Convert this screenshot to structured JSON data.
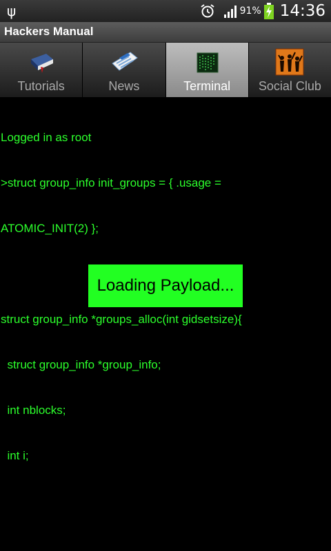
{
  "status_bar": {
    "battery_percent": "91%",
    "time": "14:36",
    "icons": [
      "usb-icon",
      "alarm-icon",
      "signal-icon",
      "battery-charging-icon"
    ]
  },
  "app": {
    "title": "Hackers Manual"
  },
  "tabs": [
    {
      "label": "Tutorials",
      "icon": "book-icon",
      "selected": false
    },
    {
      "label": "News",
      "icon": "newspaper-icon",
      "selected": false
    },
    {
      "label": "Terminal",
      "icon": "terminal-icon",
      "selected": true
    },
    {
      "label": "Social Club",
      "icon": "crowd-icon",
      "selected": false
    }
  ],
  "terminal": {
    "lines": [
      "Logged in as root",
      ">struct group_info init_groups = { .usage =",
      "ATOMIC_INIT(2) };",
      "",
      "struct group_info *groups_alloc(int gidsetsize){",
      "  struct group_info *group_info;",
      "  int nblocks;",
      "  int i;"
    ]
  },
  "loading": {
    "label": "Loading Payload..."
  },
  "colors": {
    "terminal_text": "#2cff2c",
    "loading_bg": "#22ff22",
    "background": "#000000"
  }
}
